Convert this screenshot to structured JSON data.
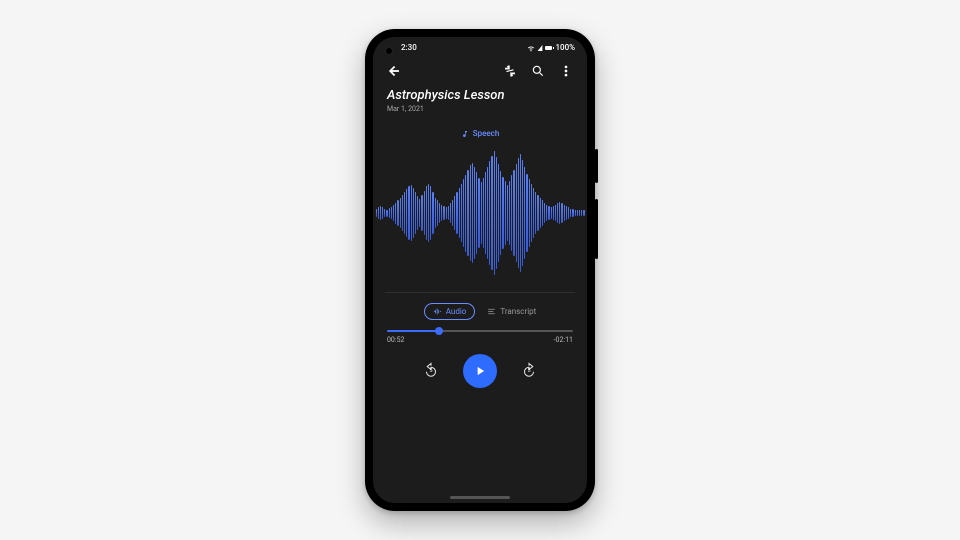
{
  "status": {
    "time": "2:30",
    "battery": "100%"
  },
  "title": "Astrophysics Lesson",
  "date": "Mar 1, 2021",
  "chip": "Speech",
  "tabs": {
    "audio": "Audio",
    "transcript": "Transcript"
  },
  "seek": {
    "elapsed": "00:52",
    "remaining": "-02:11",
    "progress_pct": 28
  },
  "skip_seconds": "5",
  "waveform": [
    6,
    8,
    10,
    8,
    6,
    5,
    7,
    9,
    12,
    15,
    18,
    22,
    26,
    30,
    34,
    38,
    40,
    36,
    30,
    24,
    20,
    26,
    32,
    38,
    42,
    38,
    30,
    22,
    18,
    14,
    12,
    10,
    8,
    10,
    14,
    18,
    24,
    30,
    36,
    42,
    48,
    55,
    62,
    68,
    72,
    66,
    58,
    50,
    44,
    50,
    58,
    66,
    74,
    82,
    88,
    80,
    70,
    60,
    52,
    46,
    40,
    46,
    54,
    62,
    70,
    78,
    84,
    76,
    66,
    56,
    48,
    42,
    36,
    30,
    26,
    22,
    18,
    14,
    12,
    10,
    8,
    10,
    12,
    14,
    16,
    14,
    12,
    10,
    8,
    6,
    6,
    4,
    4,
    4,
    4,
    4
  ]
}
